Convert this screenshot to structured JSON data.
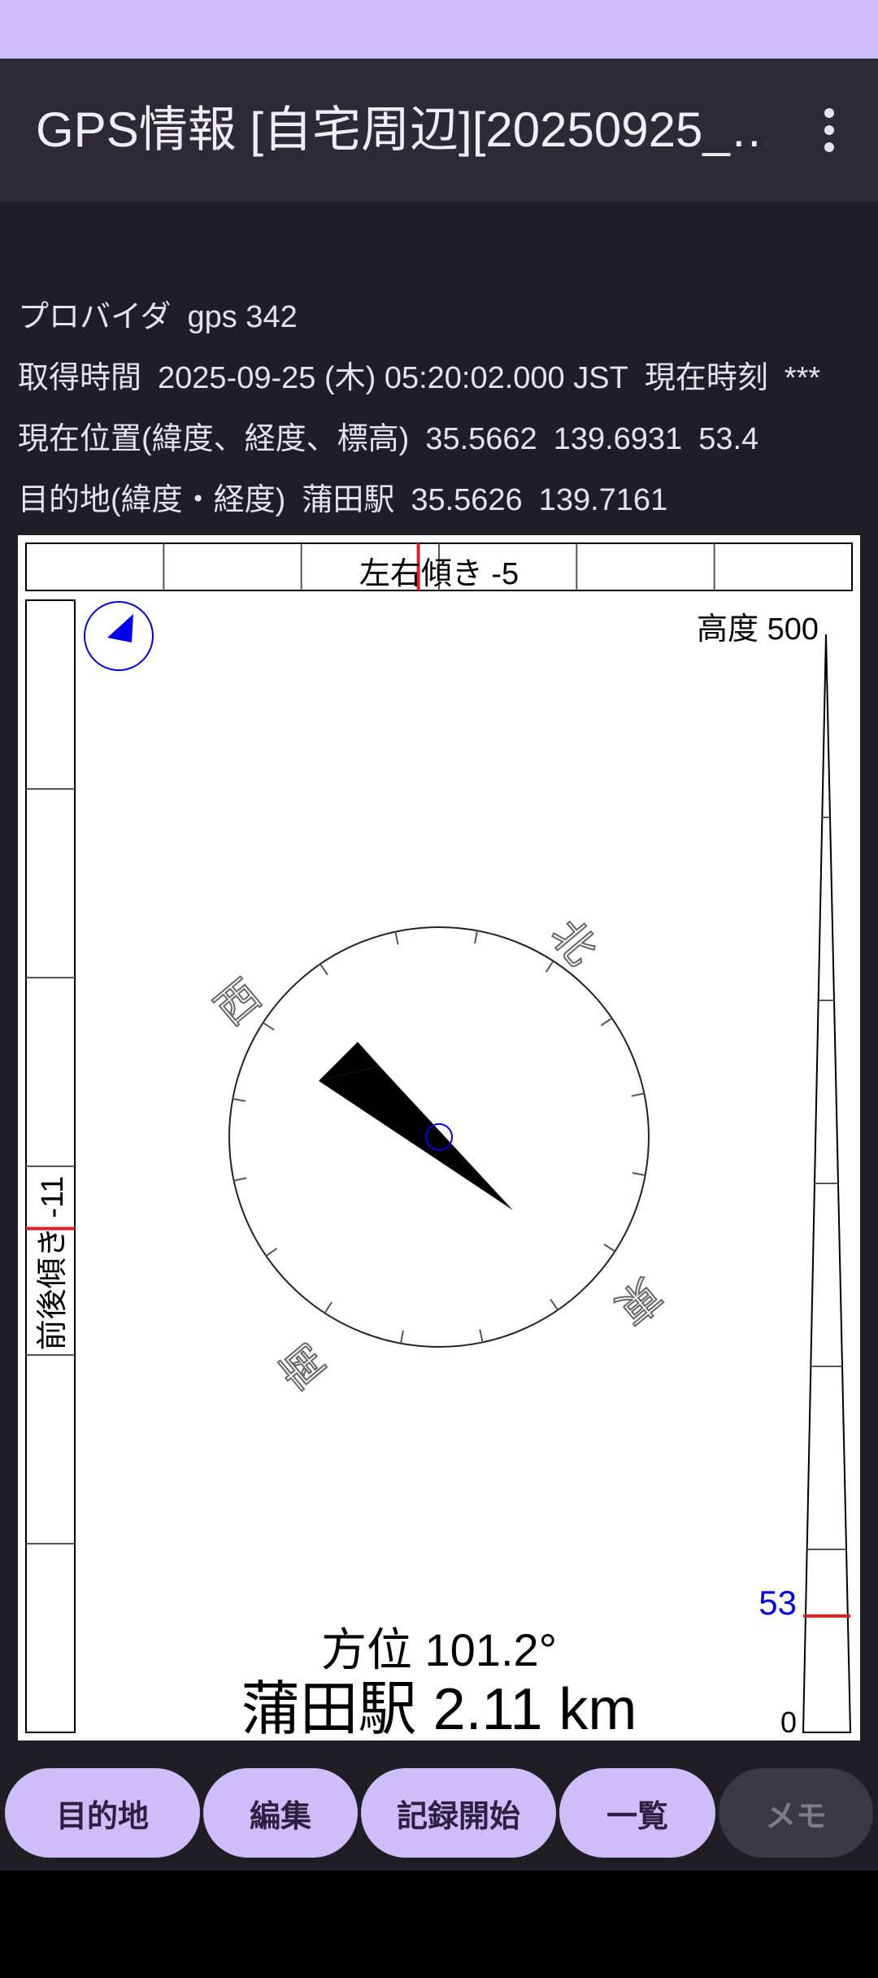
{
  "app_bar": {
    "title": "GPS情報 [自宅周辺][20250925_…",
    "menu_icon": "more-vert-icon"
  },
  "info": {
    "provider_label": "プロバイダ",
    "provider_value": "gps 342",
    "time_label": "取得時間",
    "time_value": "2025-09-25 (木) 05:20:02.000 JST",
    "now_label": "現在時刻",
    "now_value": "***",
    "pos_label": "現在位置(緯度、経度、標高)",
    "lat": "35.5662",
    "lon": "139.6931",
    "alt": "53.4",
    "dest_label": "目的地(緯度・経度)",
    "dest_name": "蒲田駅",
    "dest_lat": "35.5626",
    "dest_lon": "139.7161"
  },
  "compass": {
    "roll_label": "左右傾き -5",
    "roll": -5,
    "pitch_label": "前後傾き -11",
    "pitch": -11,
    "altitude_label": "高度 500",
    "altitude_max": 500,
    "altitude_min_label": "0",
    "altitude_value": 53,
    "altitude_value_label": "53",
    "dir_north": "北",
    "dir_east": "東",
    "dir_south": "南",
    "dir_west": "西",
    "bearing_label": "方位 101.2°",
    "bearing": 101.2,
    "distance_label": "蒲田駅 2.11 km"
  },
  "buttons": [
    {
      "label": "目的地",
      "enabled": true
    },
    {
      "label": "編集",
      "enabled": true
    },
    {
      "label": "記録開始",
      "enabled": true
    },
    {
      "label": "一覧",
      "enabled": true
    },
    {
      "label": "メモ",
      "enabled": false
    }
  ],
  "colors": {
    "accent": "#cdbdf9",
    "bar": "#2c2b33",
    "background": "#1f1e24",
    "blue": "#0000ee",
    "red": "#e02020"
  }
}
